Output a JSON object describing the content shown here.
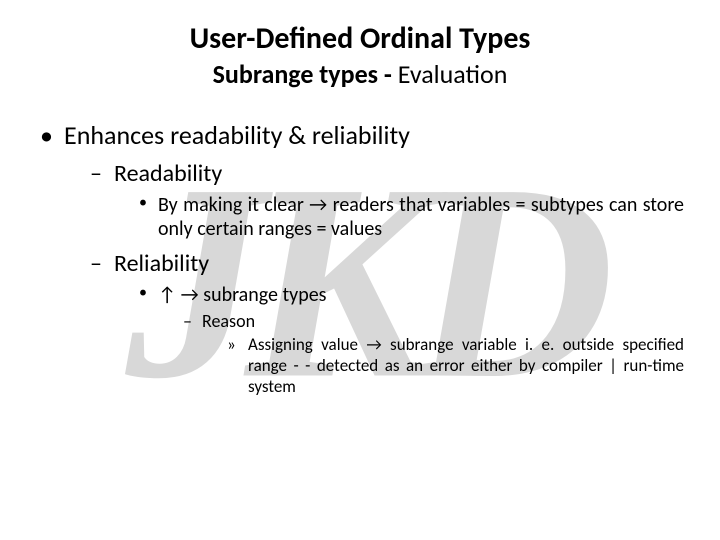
{
  "watermark": "JKD",
  "title": "User-Defined Ordinal Types",
  "subtitle_bold": "Subrange types - ",
  "subtitle_rest": "Evaluation",
  "bullets": {
    "l1": "Enhances readability & reliability",
    "l2a": "Readability",
    "l3a": "By making it clear → readers that variables = subtypes can store only certain ranges = values",
    "l2b": "Reliability",
    "l3b": "↑ → subrange types",
    "l4b": "Reason",
    "l5b": "Assigning value → subrange variable i. e. outside specified range - - detected as an error either by compiler | run-time system"
  }
}
